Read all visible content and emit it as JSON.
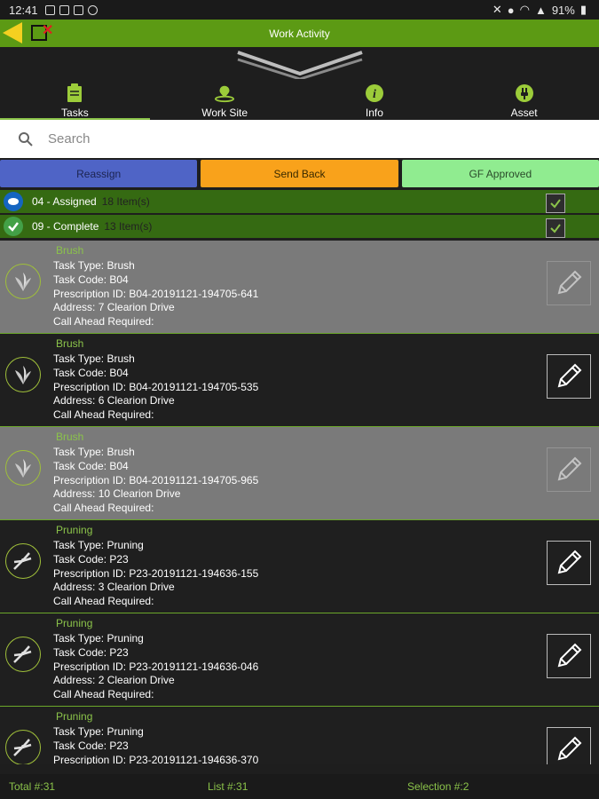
{
  "status": {
    "time": "12:41",
    "battery": "91%"
  },
  "appbar": {
    "title": "Work Activity"
  },
  "tabs": [
    {
      "label": "Tasks",
      "icon": "clipboard-icon",
      "active": true
    },
    {
      "label": "Work Site",
      "icon": "location-icon",
      "active": false
    },
    {
      "label": "Info",
      "icon": "info-icon",
      "active": false
    },
    {
      "label": "Asset",
      "icon": "plug-icon",
      "active": false
    }
  ],
  "search": {
    "placeholder": "Search",
    "value": ""
  },
  "actions": {
    "reassign": "Reassign",
    "send_back": "Send Back",
    "gf_approved": "GF Approved"
  },
  "groups": [
    {
      "title": "04 - Assigned",
      "count": "18 Item(s)",
      "color": "#1565c0"
    },
    {
      "title": "09 - Complete",
      "count": "13 Item(s)",
      "color": "#43a047"
    }
  ],
  "items": [
    {
      "category": "Brush",
      "type": "Task Type: Brush",
      "code": "Task Code: B04",
      "rx": "Prescription ID: B04-20191121-194705-641",
      "address": "Address: 7 Clearion Drive",
      "call": "Call Ahead Required:",
      "icon": "brush-icon",
      "style": "grey"
    },
    {
      "category": "Brush",
      "type": "Task Type: Brush",
      "code": "Task Code: B04",
      "rx": "Prescription ID: B04-20191121-194705-535",
      "address": "Address: 6 Clearion Drive",
      "call": "Call Ahead Required:",
      "icon": "brush-icon",
      "style": "dark"
    },
    {
      "category": "Brush",
      "type": "Task Type: Brush",
      "code": "Task Code: B04",
      "rx": "Prescription ID: B04-20191121-194705-965",
      "address": "Address: 10 Clearion Drive",
      "call": "Call Ahead Required:",
      "icon": "brush-icon",
      "style": "grey"
    },
    {
      "category": "Pruning",
      "type": "Task Type: Pruning",
      "code": "Task Code: P23",
      "rx": "Prescription ID: P23-20191121-194636-155",
      "address": "Address: 3 Clearion Drive",
      "call": "Call Ahead Required:",
      "icon": "pruner-icon",
      "style": "dark"
    },
    {
      "category": "Pruning",
      "type": "Task Type: Pruning",
      "code": "Task Code: P23",
      "rx": "Prescription ID: P23-20191121-194636-046",
      "address": "Address: 2 Clearion Drive",
      "call": "Call Ahead Required:",
      "icon": "pruner-icon",
      "style": "dark"
    },
    {
      "category": "Pruning",
      "type": "Task Type: Pruning",
      "code": "Task Code: P23",
      "rx": "Prescription ID: P23-20191121-194636-370",
      "address": "",
      "call": "",
      "icon": "pruner-icon",
      "style": "dark"
    }
  ],
  "footer": {
    "total": "Total #:31",
    "list": "List #:31",
    "selection": "Selection #:2"
  },
  "colors": {
    "appbar": "#5c9a14",
    "accent": "#8bc34a",
    "group_bg": "#356a12"
  }
}
